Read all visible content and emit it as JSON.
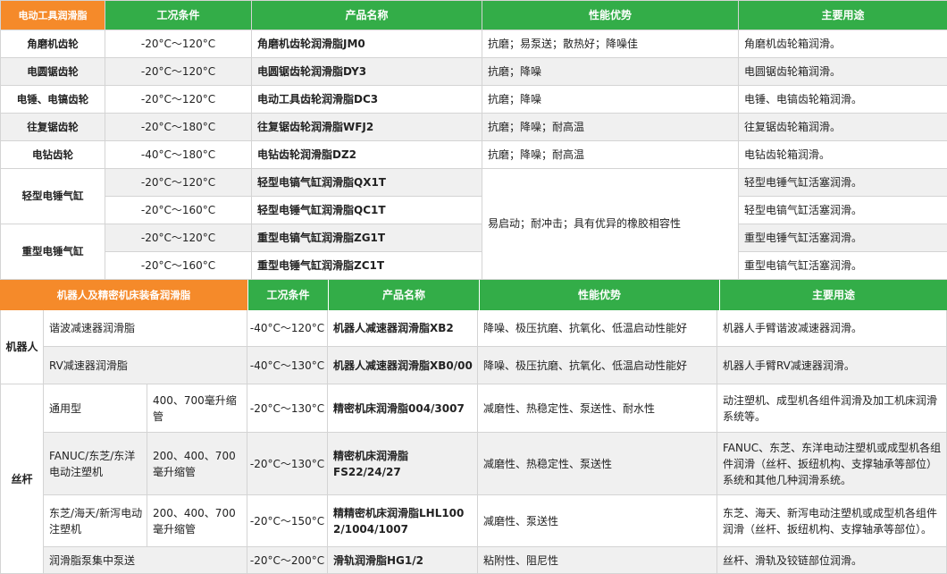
{
  "table1": {
    "headers": [
      "电动工具润滑脂",
      "工况条件",
      "产品名称",
      "性能优势",
      "主要用途"
    ],
    "rows": [
      {
        "category": "角磨机齿轮",
        "condition": "-20°C～120°C",
        "product": "角磨机齿轮润滑脂JM0",
        "advantage": "抗磨；易泵送；散热好；降噪佳",
        "usage": "角磨机齿轮箱润滑。"
      },
      {
        "category": "电圆锯齿轮",
        "condition": "-20°C～120°C",
        "product": "电圆锯齿轮润滑脂DY3",
        "advantage": "抗磨；降噪",
        "usage": "电圆锯齿轮箱润滑。"
      },
      {
        "category": "电锤、电镐齿轮",
        "condition": "-20°C～120°C",
        "product": "电动工具齿轮润滑脂DC3",
        "advantage": "抗磨；降噪",
        "usage": "电锤、电镐齿轮箱润滑。"
      },
      {
        "category": "往复锯齿轮",
        "condition": "-20°C～180°C",
        "product": "往复锯齿轮润滑脂WFJ2",
        "advantage": "抗磨；降噪；耐高温",
        "usage": "往复锯齿轮箱润滑。"
      },
      {
        "category": "电钻齿轮",
        "condition": "-40°C～180°C",
        "product": "电钻齿轮润滑脂DZ2",
        "advantage": "抗磨；降噪；耐高温",
        "usage": "电钻齿轮箱润滑。"
      }
    ],
    "light_category": "轻型电锤气缸",
    "heavy_category": "重型电锤气缸",
    "shared_advantage": "易启动；耐冲击；具有优异的橡胶相容性",
    "light_rows": [
      {
        "condition": "-20°C～120°C",
        "product": "轻型电镐气缸润滑脂QX1T",
        "usage": "轻型电锤气缸活塞润滑。"
      },
      {
        "condition": "-20°C～160°C",
        "product": "轻型电锤气缸润滑脂QC1T",
        "usage": "轻型电镐气缸活塞润滑。"
      }
    ],
    "heavy_rows": [
      {
        "condition": "-20°C～120°C",
        "product": "重型电镐气缸润滑脂ZG1T",
        "usage": "重型电锤气缸活塞润滑。"
      },
      {
        "condition": "-20°C～160°C",
        "product": "重型电锤气缸润滑脂ZC1T",
        "usage": "重型电镐气缸活塞润滑。"
      }
    ]
  },
  "table2": {
    "headers": [
      "机器人及精密机床装备润滑脂",
      "工况条件",
      "产品名称",
      "性能优势",
      "主要用途"
    ],
    "robot_group": "机器人",
    "robot_rows": [
      {
        "sub": "谐波减速器润滑脂",
        "condition": "-40°C～120°C",
        "product": "机器人减速器润滑脂XB2",
        "advantage": "降噪、极压抗磨、抗氧化、低温启动性能好",
        "usage": "机器人手臂谐波减速器润滑。"
      },
      {
        "sub": "RV减速器润滑脂",
        "condition": "-40°C～130°C",
        "product": "机器人减速器润滑脂XB0/00",
        "advantage": "降噪、极压抗磨、抗氧化、低温启动性能好",
        "usage": "机器人手臂RV减速器润滑。"
      }
    ],
    "screw_group": "丝杆",
    "screw_rows": [
      {
        "sub": "通用型",
        "tube": "400、700毫升缩管",
        "condition": "-20°C～130°C",
        "product": "精密机床润滑脂004/3007",
        "advantage": "减磨性、热稳定性、泵送性、耐水性",
        "usage": "动注塑机、成型机各组件润滑及加工机床润滑系统等。"
      },
      {
        "sub": "FANUC/东芝/东洋电动注塑机",
        "tube": "200、400、700毫升缩管",
        "condition": "-20°C～130°C",
        "product": "精密机床润滑脂FS22/24/27",
        "advantage": "减磨性、热稳定性、泵送性",
        "usage": "FANUC、东芝、东洋电动注塑机或成型机各组件润滑（丝杆、扳纽机构、支撑轴承等部位）系统和其他几种润滑系统。"
      },
      {
        "sub": "东芝/海天/新泻电动注塑机",
        "tube": "200、400、700毫升缩管",
        "condition": "-20°C～150°C",
        "product": "精精密机床润滑脂LHL1002/1004/1007",
        "advantage": "减磨性、泵送性",
        "usage": "东芝、海天、新泻电动注塑机或成型机各组件润滑（丝杆、扳纽机构、支撑轴承等部位）。"
      },
      {
        "sub": "润滑脂泵集中泵送",
        "condition": "-20°C～200°C",
        "product": "滑轨润滑脂HG1/2",
        "advantage": "粘附性、阻尼性",
        "usage": "丝杆、滑轨及铰链部位润滑。"
      }
    ]
  }
}
